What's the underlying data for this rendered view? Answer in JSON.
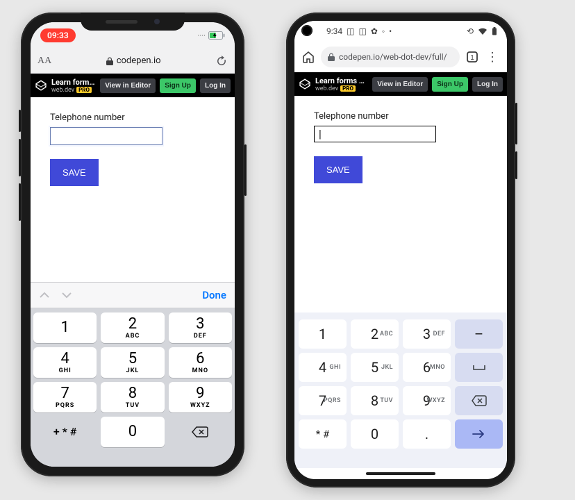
{
  "iphone": {
    "status": {
      "time": "09:33"
    },
    "browser": {
      "aa": "AA",
      "lock": "🔒",
      "domain": "codepen.io"
    },
    "codepen": {
      "title": "Learn forms – virt...",
      "author": "web.dev",
      "pro": "PRO",
      "view": "View in Editor",
      "signup": "Sign Up",
      "login": "Log In"
    },
    "form": {
      "label": "Telephone number",
      "value": "",
      "save": "SAVE"
    },
    "accessory": {
      "done": "Done"
    },
    "keypad": {
      "rows": [
        [
          {
            "d": "1",
            "s": ""
          },
          {
            "d": "2",
            "s": "ABC"
          },
          {
            "d": "3",
            "s": "DEF"
          }
        ],
        [
          {
            "d": "4",
            "s": "GHI"
          },
          {
            "d": "5",
            "s": "JKL"
          },
          {
            "d": "6",
            "s": "MNO"
          }
        ],
        [
          {
            "d": "7",
            "s": "PQRS"
          },
          {
            "d": "8",
            "s": "TUV"
          },
          {
            "d": "9",
            "s": "WXYZ"
          }
        ]
      ],
      "symbols": "+ * #",
      "zero": "0"
    }
  },
  "android": {
    "status": {
      "time": "9:34"
    },
    "browser": {
      "url": "codepen.io/web-dot-dev/full/",
      "tabs": "1"
    },
    "codepen": {
      "title": "Learn forms – virt...",
      "author": "web.dev",
      "pro": "PRO",
      "view": "View in Editor",
      "signup": "Sign Up",
      "login": "Log In"
    },
    "form": {
      "label": "Telephone number",
      "value": "",
      "placeholder": "|",
      "save": "SAVE"
    },
    "keypad": {
      "rows": [
        [
          {
            "d": "1",
            "s": ""
          },
          {
            "d": "2",
            "s": "ABC"
          },
          {
            "d": "3",
            "s": "DEF"
          }
        ],
        [
          {
            "d": "4",
            "s": "GHI"
          },
          {
            "d": "5",
            "s": "JKL"
          },
          {
            "d": "6",
            "s": "MNO"
          }
        ],
        [
          {
            "d": "7",
            "s": "PQRS"
          },
          {
            "d": "8",
            "s": "TUV"
          },
          {
            "d": "9",
            "s": "WXYZ"
          }
        ]
      ],
      "symbols": "* #",
      "zero": "0",
      "dot": ".",
      "dash": "–",
      "space": "⎵"
    }
  }
}
